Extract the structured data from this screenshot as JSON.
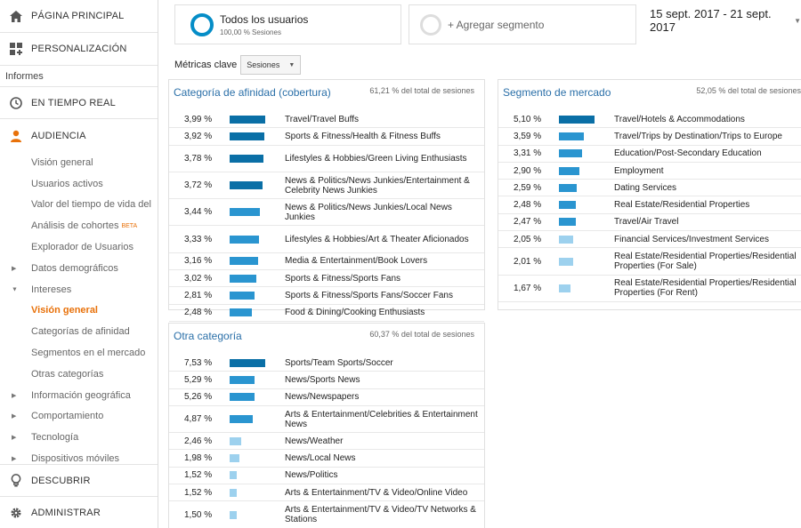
{
  "sidebar": {
    "home": "PÁGINA PRINCIPAL",
    "custom": "PERSONALIZACIÓN",
    "reports_label": "Informes",
    "realtime": "EN TIEMPO REAL",
    "audience": "AUDIENCIA",
    "items": [
      {
        "label": "Visión general",
        "caret": ""
      },
      {
        "label": "Usuarios activos",
        "caret": ""
      },
      {
        "label": "Valor del tiempo de vida del",
        "caret": ""
      },
      {
        "label": "Análisis de cohortes",
        "caret": "",
        "badge": "BETA"
      },
      {
        "label": "Explorador de Usuarios",
        "caret": ""
      },
      {
        "label": "Datos demográficos",
        "caret": "▶"
      },
      {
        "label": "Intereses",
        "caret": "▼"
      },
      {
        "label": "Visión general",
        "caret": "",
        "active": true
      },
      {
        "label": "Categorías de afinidad",
        "caret": ""
      },
      {
        "label": "Segmentos en el mercado",
        "caret": ""
      },
      {
        "label": "Otras categorías",
        "caret": ""
      },
      {
        "label": "Información geográfica",
        "caret": "▶"
      },
      {
        "label": "Comportamiento",
        "caret": "▶"
      },
      {
        "label": "Tecnología",
        "caret": "▶"
      },
      {
        "label": "Dispositivos móviles",
        "caret": "▶"
      }
    ],
    "discover": "DESCUBRIR",
    "admin": "ADMINISTRAR"
  },
  "segments": {
    "all_title": "Todos los usuarios",
    "all_sub": "100,00 % Sesiones",
    "add": "+ Agregar segmento"
  },
  "date_range": "15 sept. 2017 - 21 sept. 2017",
  "metrics": {
    "label": "Métricas clave",
    "select": "Sesiones"
  },
  "colors": {
    "bar_dark": "#0a6fa6",
    "bar_mid": "#2a95d0",
    "bar_light": "#9dd1ee",
    "link": "#2a6fa8",
    "accent": "#e8710a"
  },
  "cards": {
    "affinity": {
      "title": "Categoría de afinidad (cobertura)",
      "note": "61,21 % del total de sesiones",
      "rows": [
        {
          "pct": "3,99 %",
          "value": 3.99,
          "label": "Travel/Travel Buffs"
        },
        {
          "pct": "3,92 %",
          "value": 3.92,
          "label": "Sports & Fitness/Health & Fitness Buffs"
        },
        {
          "pct": "3,78 %",
          "value": 3.78,
          "label": "Lifestyles & Hobbies/Green Living Enthusiasts"
        },
        {
          "pct": "3,72 %",
          "value": 3.72,
          "label": "News & Politics/News Junkies/Entertainment & Celebrity News Junkies"
        },
        {
          "pct": "3,44 %",
          "value": 3.44,
          "label": "News & Politics/News Junkies/Local News Junkies"
        },
        {
          "pct": "3,33 %",
          "value": 3.33,
          "label": "Lifestyles & Hobbies/Art & Theater Aficionados"
        },
        {
          "pct": "3,16 %",
          "value": 3.16,
          "label": "Media & Entertainment/Book Lovers"
        },
        {
          "pct": "3,02 %",
          "value": 3.02,
          "label": "Sports & Fitness/Sports Fans"
        },
        {
          "pct": "2,81 %",
          "value": 2.81,
          "label": "Sports & Fitness/Sports Fans/Soccer Fans"
        },
        {
          "pct": "2,48 %",
          "value": 2.48,
          "label": "Food & Dining/Cooking Enthusiasts"
        }
      ]
    },
    "market": {
      "title": "Segmento de mercado",
      "note": "52,05 % del total de sesiones",
      "rows": [
        {
          "pct": "5,10 %",
          "value": 5.1,
          "label": "Travel/Hotels & Accommodations"
        },
        {
          "pct": "3,59 %",
          "value": 3.59,
          "label": "Travel/Trips by Destination/Trips to Europe"
        },
        {
          "pct": "3,31 %",
          "value": 3.31,
          "label": "Education/Post-Secondary Education"
        },
        {
          "pct": "2,90 %",
          "value": 2.9,
          "label": "Employment"
        },
        {
          "pct": "2,59 %",
          "value": 2.59,
          "label": "Dating Services"
        },
        {
          "pct": "2,48 %",
          "value": 2.48,
          "label": "Real Estate/Residential Properties"
        },
        {
          "pct": "2,47 %",
          "value": 2.47,
          "label": "Travel/Air Travel"
        },
        {
          "pct": "2,05 %",
          "value": 2.05,
          "label": "Financial Services/Investment Services"
        },
        {
          "pct": "2,01 %",
          "value": 2.01,
          "label": "Real Estate/Residential Properties/Residential Properties (For Sale)"
        },
        {
          "pct": "1,67 %",
          "value": 1.67,
          "label": "Real Estate/Residential Properties/Residential Properties (For Rent)"
        }
      ]
    },
    "other": {
      "title": "Otra categoría",
      "note": "60,37 % del total de sesiones",
      "rows": [
        {
          "pct": "7,53 %",
          "value": 7.53,
          "label": "Sports/Team Sports/Soccer"
        },
        {
          "pct": "5,29 %",
          "value": 5.29,
          "label": "News/Sports News"
        },
        {
          "pct": "5,26 %",
          "value": 5.26,
          "label": "News/Newspapers"
        },
        {
          "pct": "4,87 %",
          "value": 4.87,
          "label": "Arts & Entertainment/Celebrities & Entertainment News"
        },
        {
          "pct": "2,46 %",
          "value": 2.46,
          "label": "News/Weather"
        },
        {
          "pct": "1,98 %",
          "value": 1.98,
          "label": "News/Local News"
        },
        {
          "pct": "1,52 %",
          "value": 1.52,
          "label": "News/Politics"
        },
        {
          "pct": "1,52 %",
          "value": 1.52,
          "label": "Arts & Entertainment/TV & Video/Online Video"
        },
        {
          "pct": "1,50 %",
          "value": 1.5,
          "label": "Arts & Entertainment/TV & Video/TV Networks & Stations"
        }
      ]
    }
  }
}
